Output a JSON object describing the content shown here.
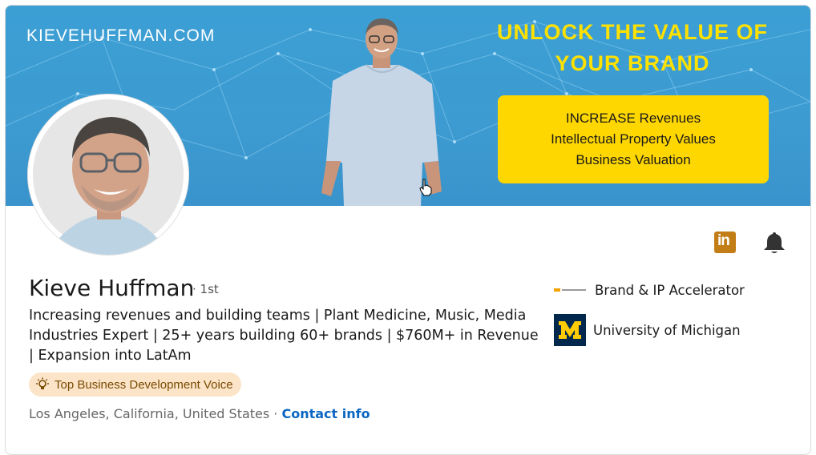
{
  "banner": {
    "site_url": "KIEVEHUFFMAN.COM",
    "headline_line1": "UNLOCK THE VALUE OF",
    "headline_line2": "YOUR BRAND",
    "promo_lines": [
      "INCREASE Revenues",
      "Intellectual Property Values",
      "Business Valuation"
    ],
    "colors": {
      "background": "#3b9fd4",
      "headline": "#ffe100",
      "promo_box": "#ffd700"
    }
  },
  "profile": {
    "name": "Kieve Huffman",
    "degree": "· 1st",
    "headline": "Increasing revenues and building teams | Plant Medicine, Music, Media Industries Expert | 25+ years building 60+ brands | $760M+ in Revenue | Expansion into LatAm",
    "badge": {
      "icon": "lightbulb-icon",
      "label": "Top Business Development Voice"
    },
    "location": "Los Angeles, California, United States",
    "separator": " · ",
    "contact_link": "Contact info"
  },
  "organizations": [
    {
      "logo_text": "kieve huffman",
      "label": "Brand & IP Accelerator"
    },
    {
      "logo_text": "M",
      "label": "University of Michigan"
    }
  ],
  "actions": {
    "linkedin_icon_text": "in",
    "bell_icon": "bell-icon"
  },
  "colors": {
    "link": "#0a66c2",
    "badge_bg": "#fbe4c8",
    "linkedin_icon": "#c37d16",
    "umich_blue": "#00274c",
    "umich_maize": "#ffcb05"
  }
}
